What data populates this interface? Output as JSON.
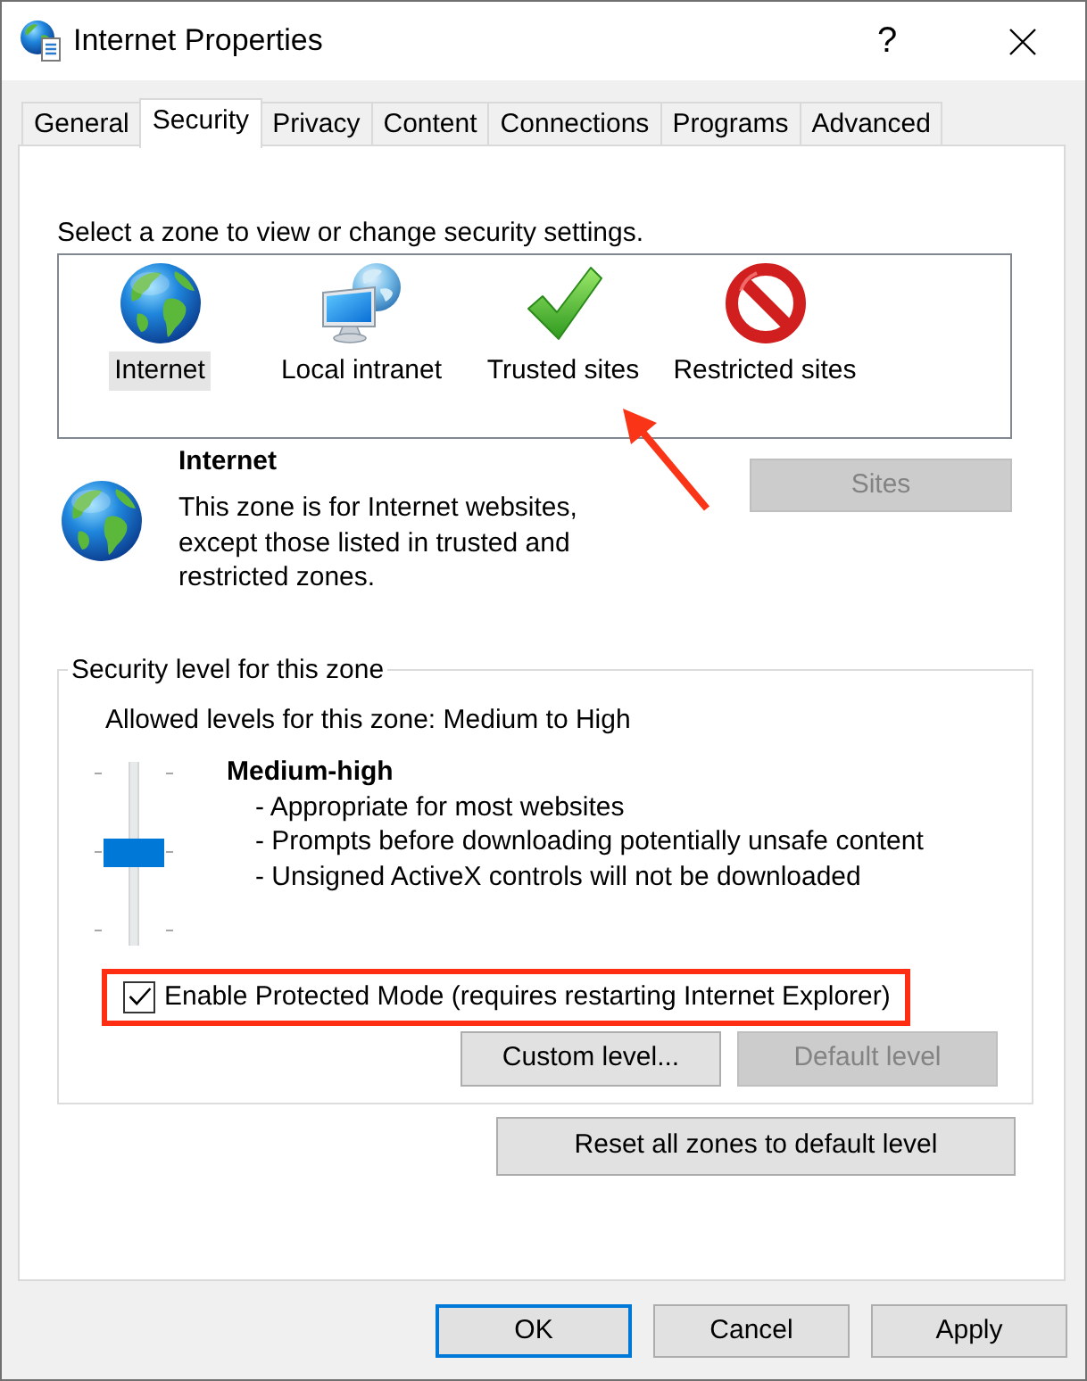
{
  "window": {
    "title": "Internet Properties",
    "help": "?"
  },
  "tabs": [
    {
      "label": "General",
      "selected": false
    },
    {
      "label": "Security",
      "selected": true
    },
    {
      "label": "Privacy",
      "selected": false
    },
    {
      "label": "Content",
      "selected": false
    },
    {
      "label": "Connections",
      "selected": false
    },
    {
      "label": "Programs",
      "selected": false
    },
    {
      "label": "Advanced",
      "selected": false
    }
  ],
  "security": {
    "zone_prompt": "Select a zone to view or change security settings.",
    "zones": [
      {
        "kind": "globe",
        "label": "Internet",
        "selected": true,
        "marked": false
      },
      {
        "kind": "network",
        "label": "Local intranet",
        "selected": false,
        "marked": false
      },
      {
        "kind": "check",
        "label": "Trusted sites",
        "selected": false,
        "marked": true
      },
      {
        "kind": "blocked",
        "label": "Restricted sites",
        "selected": false,
        "marked": false
      }
    ],
    "zone_info": {
      "kind": "globe",
      "title": "Internet",
      "description": "This zone is for Internet websites, except those listed in trusted and restricted zones."
    },
    "sites_button": {
      "label": "Sites",
      "disabled": true
    },
    "level_group": {
      "legend": "Security level for this zone",
      "allowed": "Allowed levels for this zone: Medium to High",
      "level": 0.5,
      "level_name": "Medium-high",
      "details": [
        "- Appropriate for most websites",
        "- Prompts before downloading potentially unsafe content",
        "- Unsigned ActiveX controls will not be downloaded"
      ]
    },
    "protected_mode": {
      "label": "Enable Protected Mode (requires restarting Internet Explorer)",
      "checked": true,
      "highlighted": true
    },
    "level_buttons": [
      {
        "label": "Custom level...",
        "disabled": false
      },
      {
        "label": "Default level",
        "disabled": true
      }
    ],
    "reset_button": {
      "label": "Reset all zones to default level",
      "disabled": false
    }
  },
  "dialog_buttons": [
    {
      "label": "OK",
      "default": true
    },
    {
      "label": "Cancel",
      "default": false
    },
    {
      "label": "Apply",
      "default": false
    }
  ]
}
